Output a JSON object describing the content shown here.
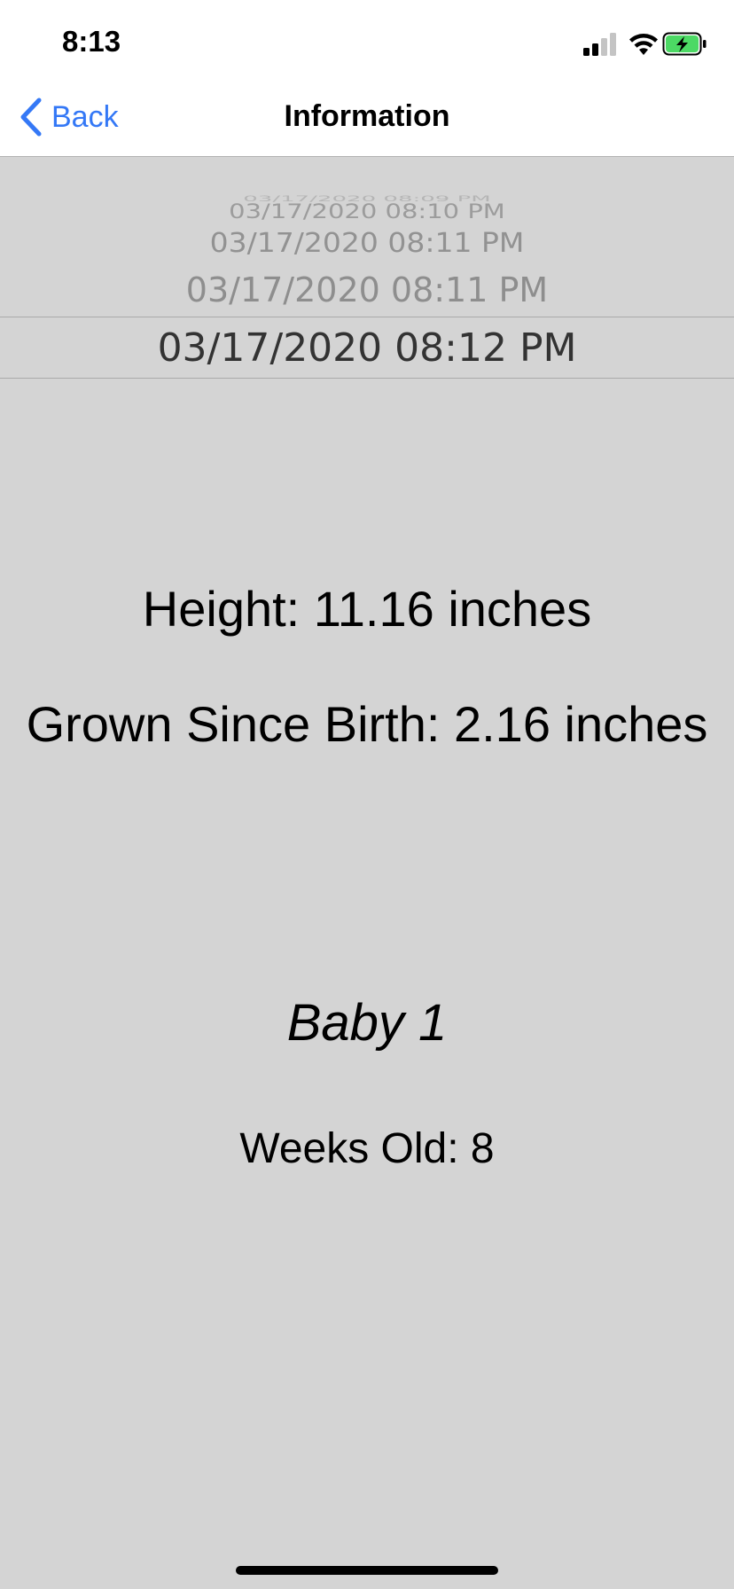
{
  "status_bar": {
    "time": "8:13",
    "icons": [
      "cellular-signal-icon",
      "wifi-icon",
      "battery-charging-icon"
    ]
  },
  "nav": {
    "back_label": "Back",
    "title": "Information"
  },
  "picker": {
    "rows": [
      "03/17/2020 08:09 PM",
      "03/17/2020 08:10 PM",
      "03/17/2020 08:11 PM",
      "03/17/2020 08:11 PM"
    ],
    "selected": "03/17/2020 08:12 PM"
  },
  "info": {
    "height": "Height: 11.16 inches",
    "grown": "Grown Since Birth: 2.16 inches",
    "baby_name": "Baby 1",
    "weeks_old": "Weeks Old: 8"
  },
  "colors": {
    "accent": "#3478f6",
    "background": "#d4d4d4",
    "battery": "#4cd964"
  }
}
